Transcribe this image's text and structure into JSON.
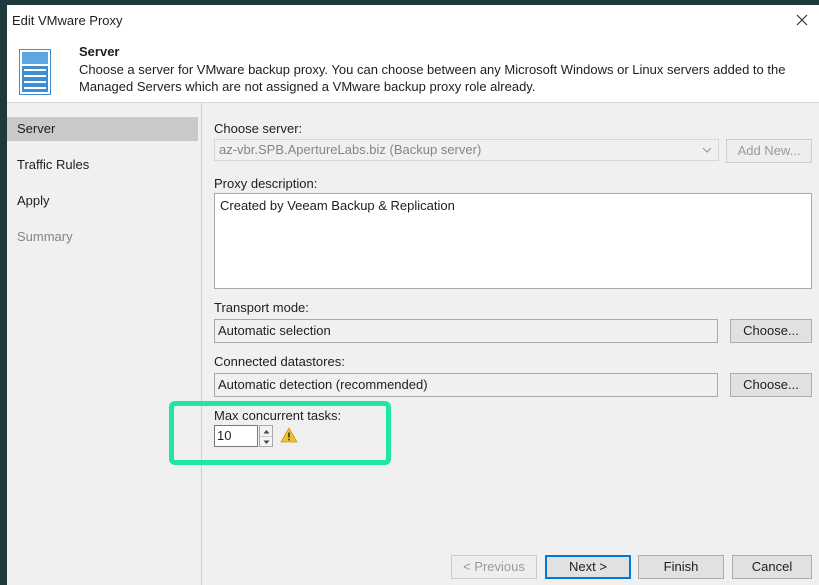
{
  "window": {
    "title": "Edit VMware Proxy"
  },
  "header": {
    "title": "Server",
    "description": "Choose a server for VMware backup proxy. You can choose between any Microsoft Windows or Linux servers added to the Managed Servers which are not assigned a VMware backup proxy role already.",
    "icon": "server-icon"
  },
  "sidebar": {
    "items": [
      {
        "label": "Server",
        "state": "active"
      },
      {
        "label": "Traffic Rules",
        "state": "enabled"
      },
      {
        "label": "Apply",
        "state": "enabled"
      },
      {
        "label": "Summary",
        "state": "disabled"
      }
    ]
  },
  "form": {
    "choose_server_label": "Choose server:",
    "choose_server_value": "az-vbr.SPB.ApertureLabs.biz (Backup server)",
    "add_new_label": "Add New...",
    "proxy_description_label": "Proxy description:",
    "proxy_description_value": "Created by Veeam Backup & Replication",
    "transport_mode_label": "Transport mode:",
    "transport_mode_value": "Automatic selection",
    "transport_choose_label": "Choose...",
    "datastores_label": "Connected datastores:",
    "datastores_value": "Automatic detection (recommended)",
    "datastores_choose_label": "Choose...",
    "max_tasks_label": "Max concurrent tasks:",
    "max_tasks_value": "10",
    "warning_icon": "warning-icon"
  },
  "footer": {
    "previous_label": "< Previous",
    "next_label": "Next >",
    "finish_label": "Finish",
    "cancel_label": "Cancel"
  },
  "colors": {
    "highlight": "#1ee8a0",
    "primary_border": "#0078d7",
    "sidebar_active": "#c9c9c9"
  }
}
